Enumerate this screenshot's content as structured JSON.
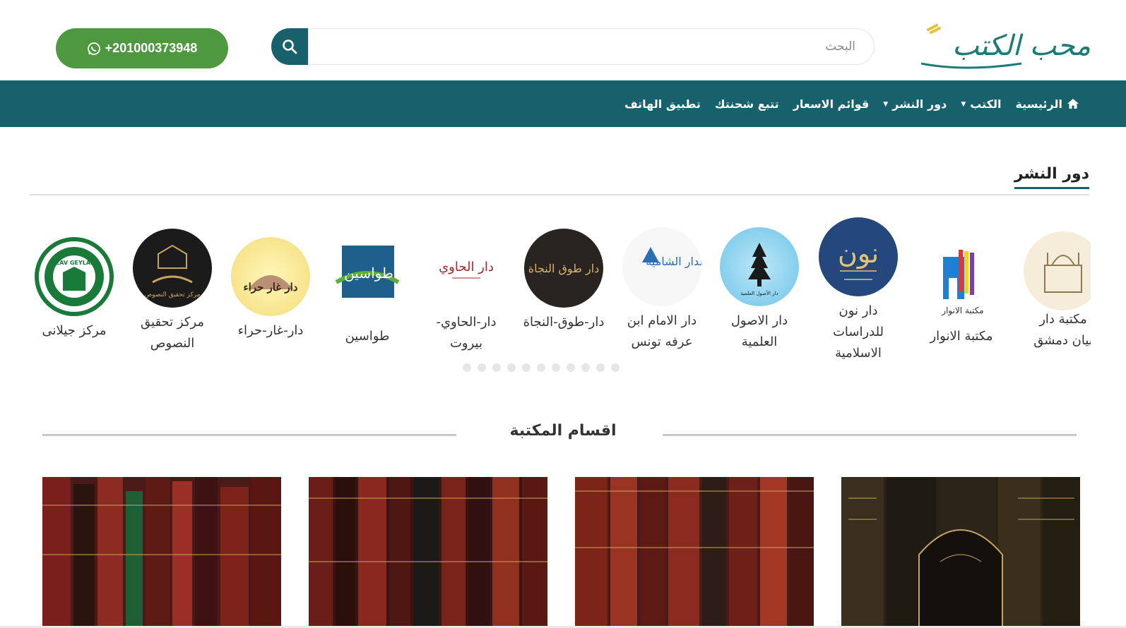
{
  "header": {
    "logo_text": "محب الكتب",
    "search_placeholder": "البحث",
    "phone": "+201000373948"
  },
  "nav": {
    "items": [
      {
        "label": "الرئيسية",
        "icon": "home-icon",
        "dropdown": false
      },
      {
        "label": "الكتب",
        "dropdown": true
      },
      {
        "label": "دور النشر",
        "dropdown": true
      },
      {
        "label": "قوائم الاسعار",
        "dropdown": false
      },
      {
        "label": "تتبع شحنتك",
        "dropdown": false
      },
      {
        "label": "تطبيق الهاتف",
        "dropdown": false
      }
    ]
  },
  "publishers": {
    "title": "دور النشر",
    "items": [
      {
        "name": "مكتبة دار البيان دمشق",
        "name_visible": "مكتبة دار\nبيان دمشق"
      },
      {
        "name": "مكتبة الانوار",
        "logo_text": "مكتبة الانوار"
      },
      {
        "name": "دار نون للدراسات الاسلامية",
        "logo_text": "نون"
      },
      {
        "name": "دار الاصول العلمية",
        "logo_text": "دار الأصول العلمية"
      },
      {
        "name": "دار الامام ابن عرفه تونس",
        "logo_text": "الدار الشامية"
      },
      {
        "name": "دار-طوق-النجاة",
        "logo_text": "دار طوق النجاة"
      },
      {
        "name": "دار-الحاوي-بيروت",
        "logo_text": "دار الحاوي"
      },
      {
        "name": "طواسين",
        "logo_text": "طواسين"
      },
      {
        "name": "دار-غار-حراء",
        "logo_text": "دار غار حراء"
      },
      {
        "name": "مركز تحقيق النصوص",
        "logo_text": "مركز تحقيق النصوص"
      },
      {
        "name": "مركز جيلانى",
        "logo_text": "GEAV GEYLANI"
      }
    ],
    "dots_count": 11
  },
  "categories": {
    "title": "اقسام المكتبة",
    "cards_count": 4
  },
  "colors": {
    "primary": "#17616d",
    "whatsapp": "#4e9840",
    "white": "#ffffff"
  }
}
